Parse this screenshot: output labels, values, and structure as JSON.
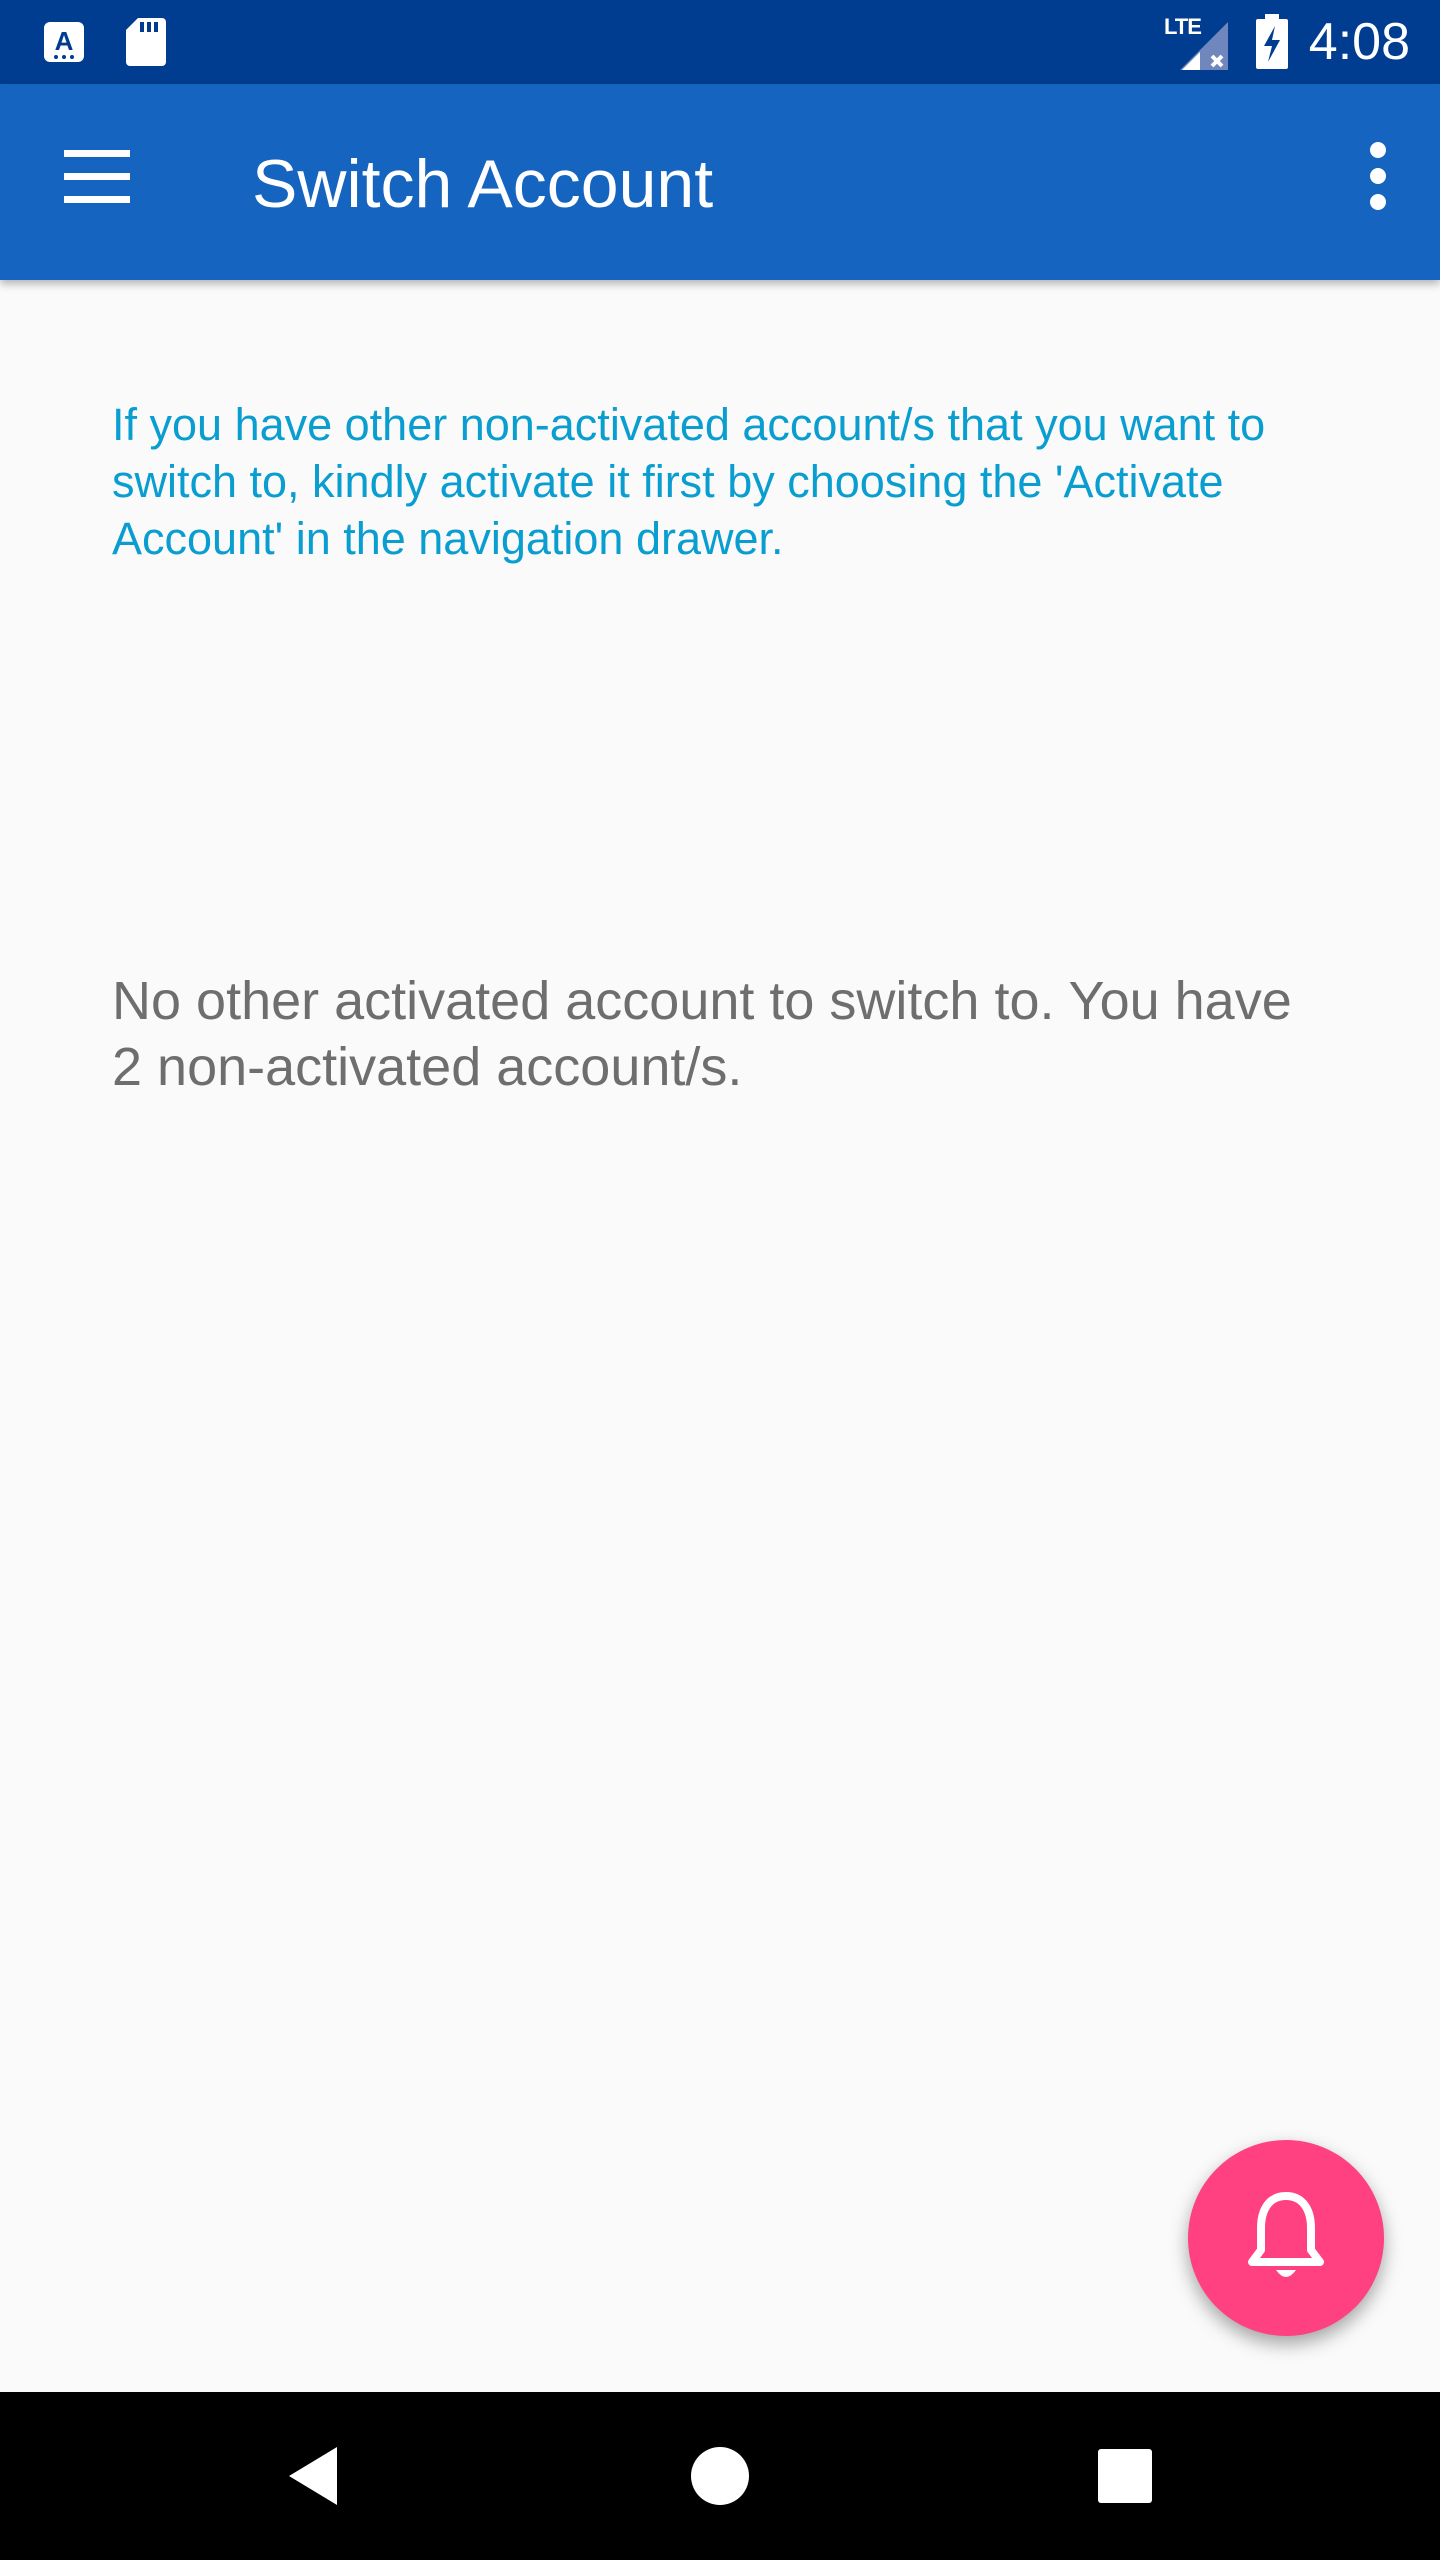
{
  "status_bar": {
    "time": "4:08",
    "network_label": "LTE",
    "icons": [
      "a-notification-icon",
      "sd-card-icon",
      "lte-signal-no-data-icon",
      "battery-charging-icon"
    ]
  },
  "app_bar": {
    "title": "Switch Account",
    "menu_icon": "hamburger-menu-icon",
    "overflow_icon": "more-vert-icon"
  },
  "content": {
    "info_message": "If you have other non-activated account/s that you want to switch to, kindly activate it first by choosing the 'Activate Account' in the navigation drawer.",
    "empty_message": "No other activated account to switch to. You have 2 non-activated account/s."
  },
  "fab": {
    "icon": "notification-bell-icon"
  },
  "nav_bar": {
    "icons": [
      "back-icon",
      "home-icon",
      "recents-icon"
    ]
  },
  "colors": {
    "status_bar": "#003C8F",
    "app_bar": "#1565C0",
    "info_text": "#0A9ED0",
    "empty_text": "#6E6E6E",
    "fab": "#FF4081",
    "background": "#FAFAFA"
  }
}
